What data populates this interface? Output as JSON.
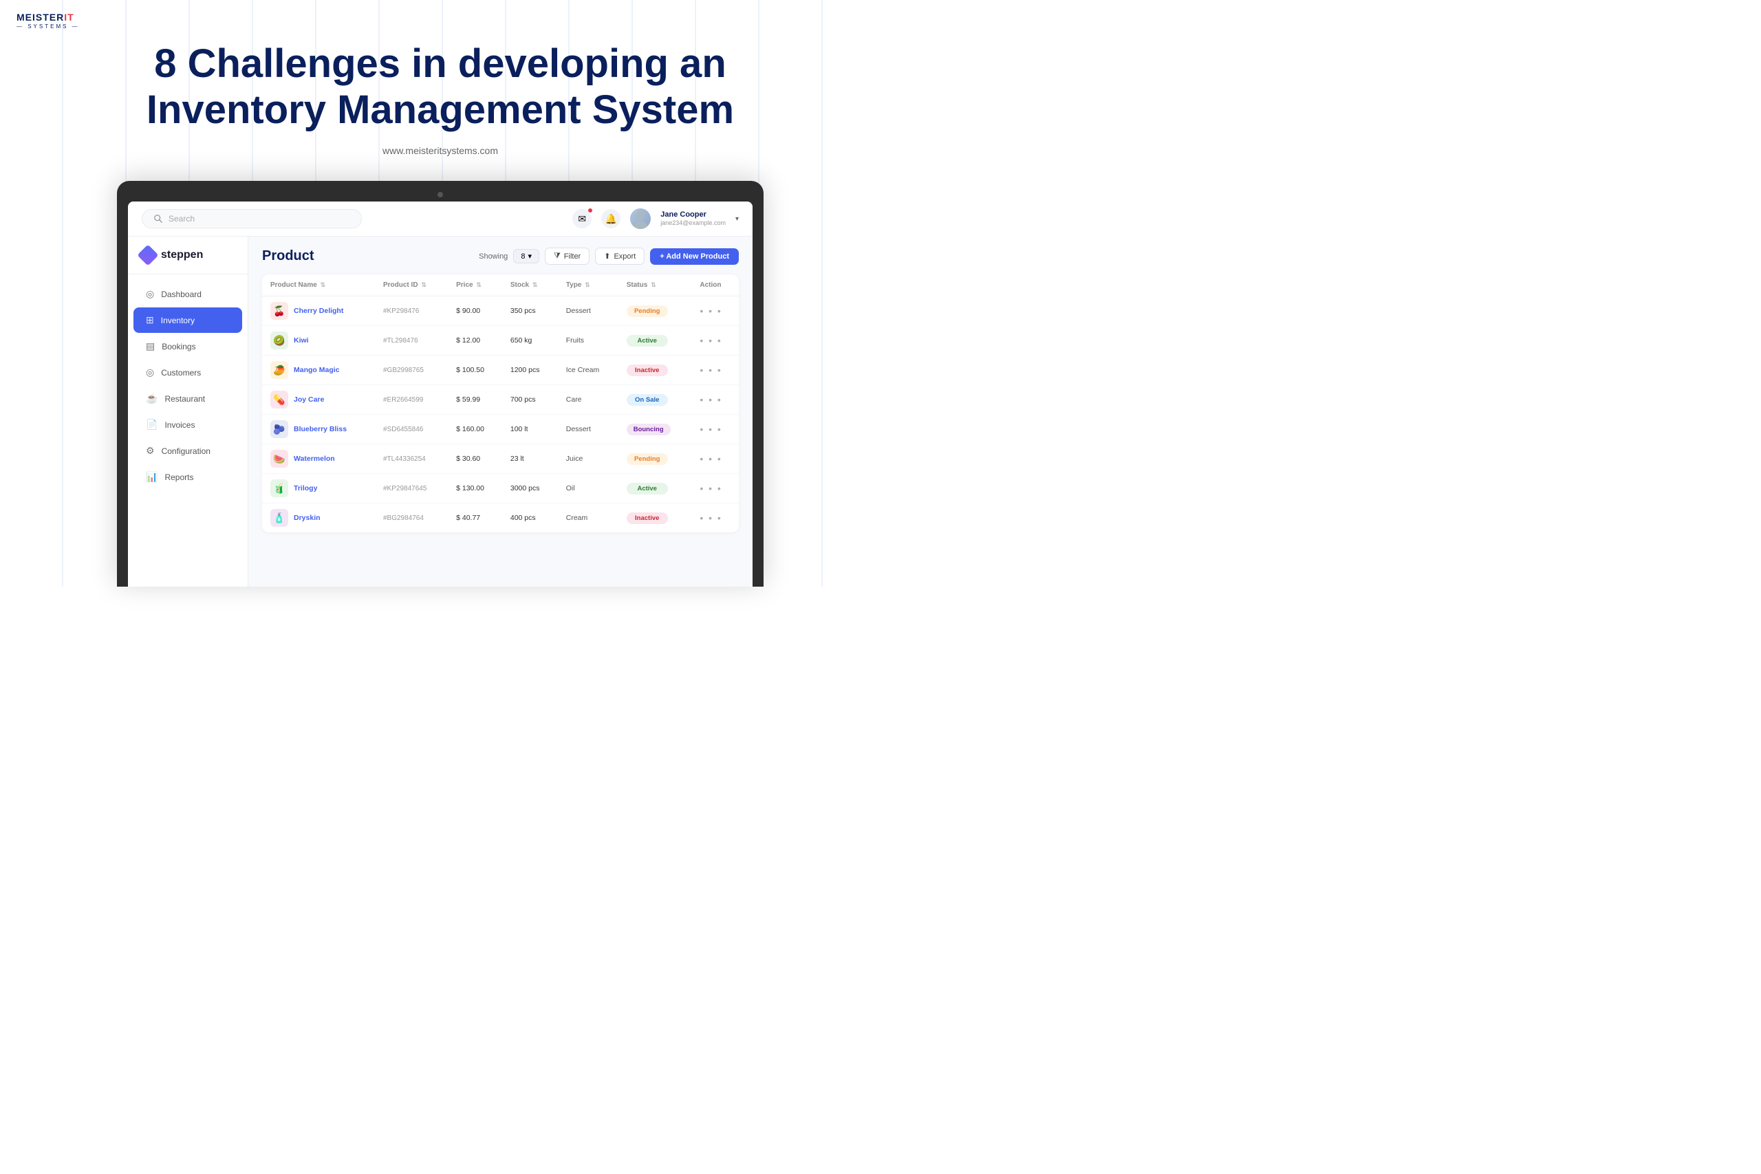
{
  "logo": {
    "name": "MEISTER",
    "it": "IT",
    "systems": "SYSTEMS",
    "separator": "———"
  },
  "title": {
    "line1": "8 Challenges in developing an",
    "line2": "Inventory Management System",
    "website": "www.meisteritsystems.com"
  },
  "app": {
    "brand": "steppen",
    "header": {
      "search_placeholder": "Search",
      "user_name": "Jane Cooper",
      "user_email": "jane234@example.com"
    },
    "sidebar": {
      "items": [
        {
          "label": "Dashboard",
          "icon": "⊙",
          "active": false
        },
        {
          "label": "Inventory",
          "icon": "⊞",
          "active": true
        },
        {
          "label": "Bookings",
          "icon": "▤",
          "active": false
        },
        {
          "label": "Customers",
          "icon": "⊙",
          "active": false
        },
        {
          "label": "Restaurant",
          "icon": "☕",
          "active": false
        },
        {
          "label": "Invoices",
          "icon": "📄",
          "active": false
        },
        {
          "label": "Configuration",
          "icon": "⚙",
          "active": false
        },
        {
          "label": "Reports",
          "icon": "📊",
          "active": false
        }
      ]
    },
    "product_section": {
      "title": "Product",
      "showing_label": "Showing",
      "showing_count": "8",
      "filter_label": "Filter",
      "export_label": "Export",
      "add_label": "+ Add New Product"
    },
    "table": {
      "columns": [
        "Product Name",
        "Product ID",
        "Price",
        "Stock",
        "Type",
        "Status",
        "Action"
      ],
      "rows": [
        {
          "emoji": "🍒",
          "bg": "#fde8e8",
          "name": "Cherry Delight",
          "id": "#KP298476",
          "price": "$ 90.00",
          "stock": "350 pcs",
          "type": "Dessert",
          "status": "Pending",
          "status_class": "status-pending"
        },
        {
          "emoji": "🥝",
          "bg": "#e8f5e9",
          "name": "Kiwi",
          "id": "#TL298476",
          "price": "$ 12.00",
          "stock": "650 kg",
          "type": "Fruits",
          "status": "Active",
          "status_class": "status-active"
        },
        {
          "emoji": "🥭",
          "bg": "#fff3e0",
          "name": "Mango Magic",
          "id": "#GB2998765",
          "price": "$ 100.50",
          "stock": "1200 pcs",
          "type": "Ice Cream",
          "status": "Inactive",
          "status_class": "status-inactive"
        },
        {
          "emoji": "💊",
          "bg": "#fce4ec",
          "name": "Joy Care",
          "id": "#ER2664599",
          "price": "$ 59.99",
          "stock": "700 pcs",
          "type": "Care",
          "status": "On Sale",
          "status_class": "status-onsale"
        },
        {
          "emoji": "🫐",
          "bg": "#e8eaf6",
          "name": "Blueberry Bliss",
          "id": "#SD6455846",
          "price": "$ 160.00",
          "stock": "100 lt",
          "type": "Dessert",
          "status": "Bouncing",
          "status_class": "status-bouncing"
        },
        {
          "emoji": "🍉",
          "bg": "#fce4ec",
          "name": "Watermelon",
          "id": "#TL44336254",
          "price": "$ 30.60",
          "stock": "23 lt",
          "type": "Juice",
          "status": "Pending",
          "status_class": "status-pending"
        },
        {
          "emoji": "🧃",
          "bg": "#e8f5e9",
          "name": "Trilogy",
          "id": "#KP29847645",
          "price": "$ 130.00",
          "stock": "3000 pcs",
          "type": "Oil",
          "status": "Active",
          "status_class": "status-active"
        },
        {
          "emoji": "🧴",
          "bg": "#f3e5f5",
          "name": "Dryskin",
          "id": "#BG2984764",
          "price": "$ 40.77",
          "stock": "400 pcs",
          "type": "Cream",
          "status": "Inactive",
          "status_class": "status-inactive"
        }
      ]
    }
  }
}
